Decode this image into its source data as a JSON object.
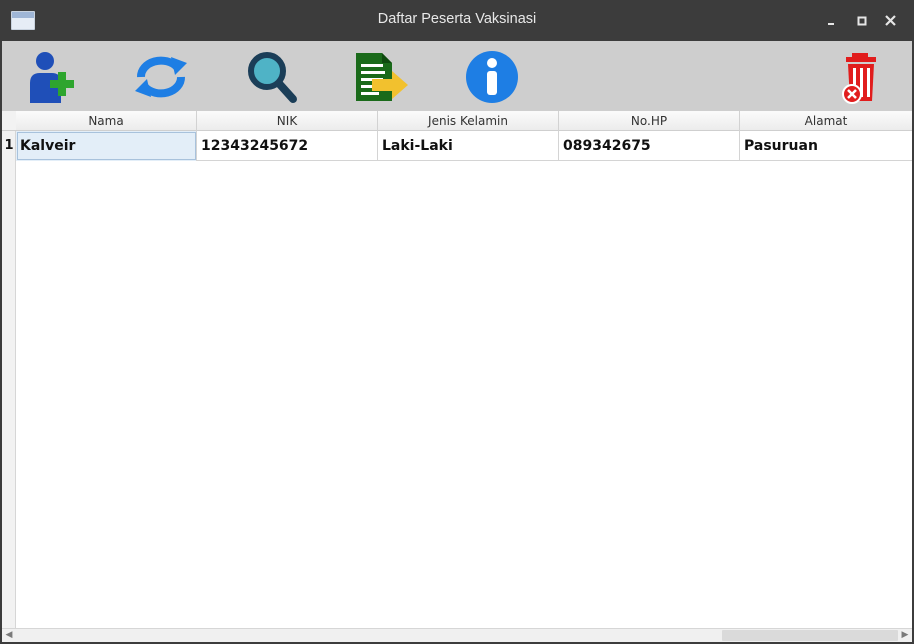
{
  "window": {
    "title": "Daftar Peserta Vaksinasi"
  },
  "toolbar": {
    "buttons": [
      {
        "name": "add-user",
        "icon": "add-user-icon"
      },
      {
        "name": "refresh",
        "icon": "refresh-icon"
      },
      {
        "name": "search",
        "icon": "search-icon"
      },
      {
        "name": "export",
        "icon": "export-document-icon"
      },
      {
        "name": "info",
        "icon": "info-icon"
      },
      {
        "name": "delete",
        "icon": "trash-icon"
      }
    ]
  },
  "table": {
    "columns": [
      "Nama",
      "NIK",
      "Jenis Kelamin",
      "No.HP",
      "Alamat"
    ],
    "rows": [
      {
        "number": "1",
        "cells": [
          "Kalveir",
          "12343245672",
          "Laki-Laki",
          "089342675",
          "Pasuruan"
        ]
      }
    ]
  },
  "colors": {
    "titlebar": "#3c3c3c",
    "toolbar": "#cecece",
    "accent_blue": "#1e7ee4",
    "delete_red": "#e11d1d",
    "add_green": "#2ea52e"
  }
}
